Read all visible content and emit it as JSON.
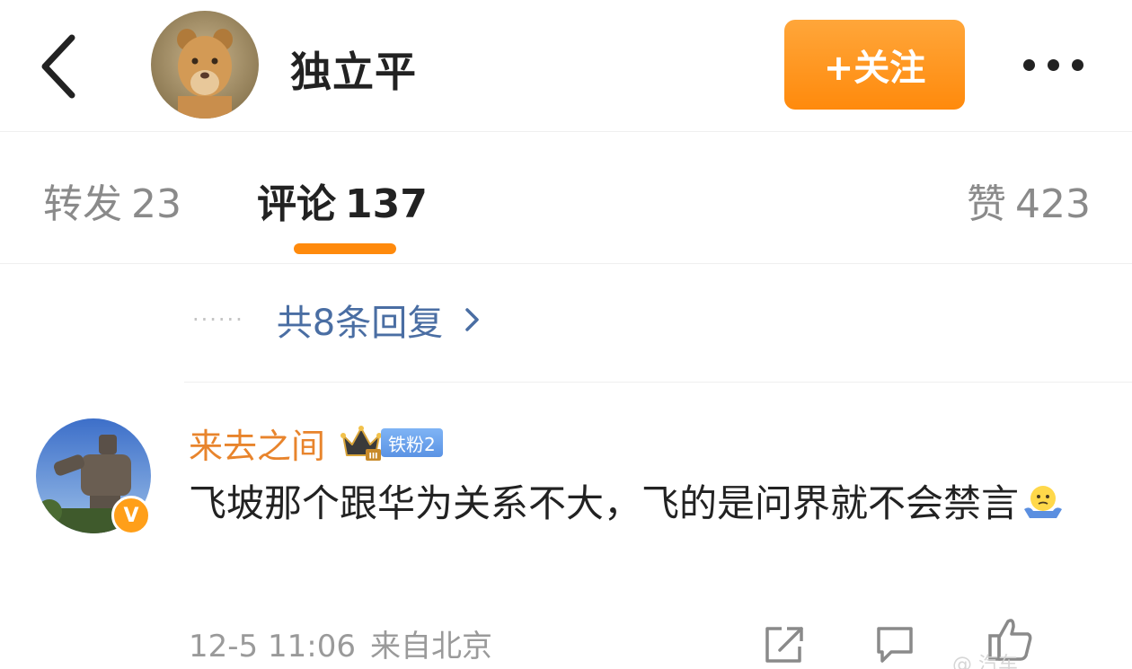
{
  "header": {
    "username": "独立平",
    "follow_label": "+关注"
  },
  "tabs": [
    {
      "label": "转发",
      "count": "23"
    },
    {
      "label": "评论",
      "count": "137"
    },
    {
      "label": "赞",
      "count": "423"
    }
  ],
  "replies": {
    "dots": "······",
    "label": "共8条回复"
  },
  "comment": {
    "user": "来去之间",
    "fan_badge": "铁粉2",
    "crown_level": "III",
    "verify_mark": "V",
    "text": "飞坡那个跟华为关系不大，飞的是问界就不会禁言",
    "time": "12-5 11:06",
    "location": "来自北京"
  },
  "watermark": "@ 汽车",
  "colors": {
    "accent": "#ff8a0c",
    "link": "#4a6ea3",
    "username": "#e8842c",
    "muted": "#8a8a8a"
  },
  "icons": {
    "back": "chevron-left-icon",
    "more": "more-icon",
    "share": "share-icon",
    "reply": "comment-icon",
    "like": "like-icon"
  }
}
